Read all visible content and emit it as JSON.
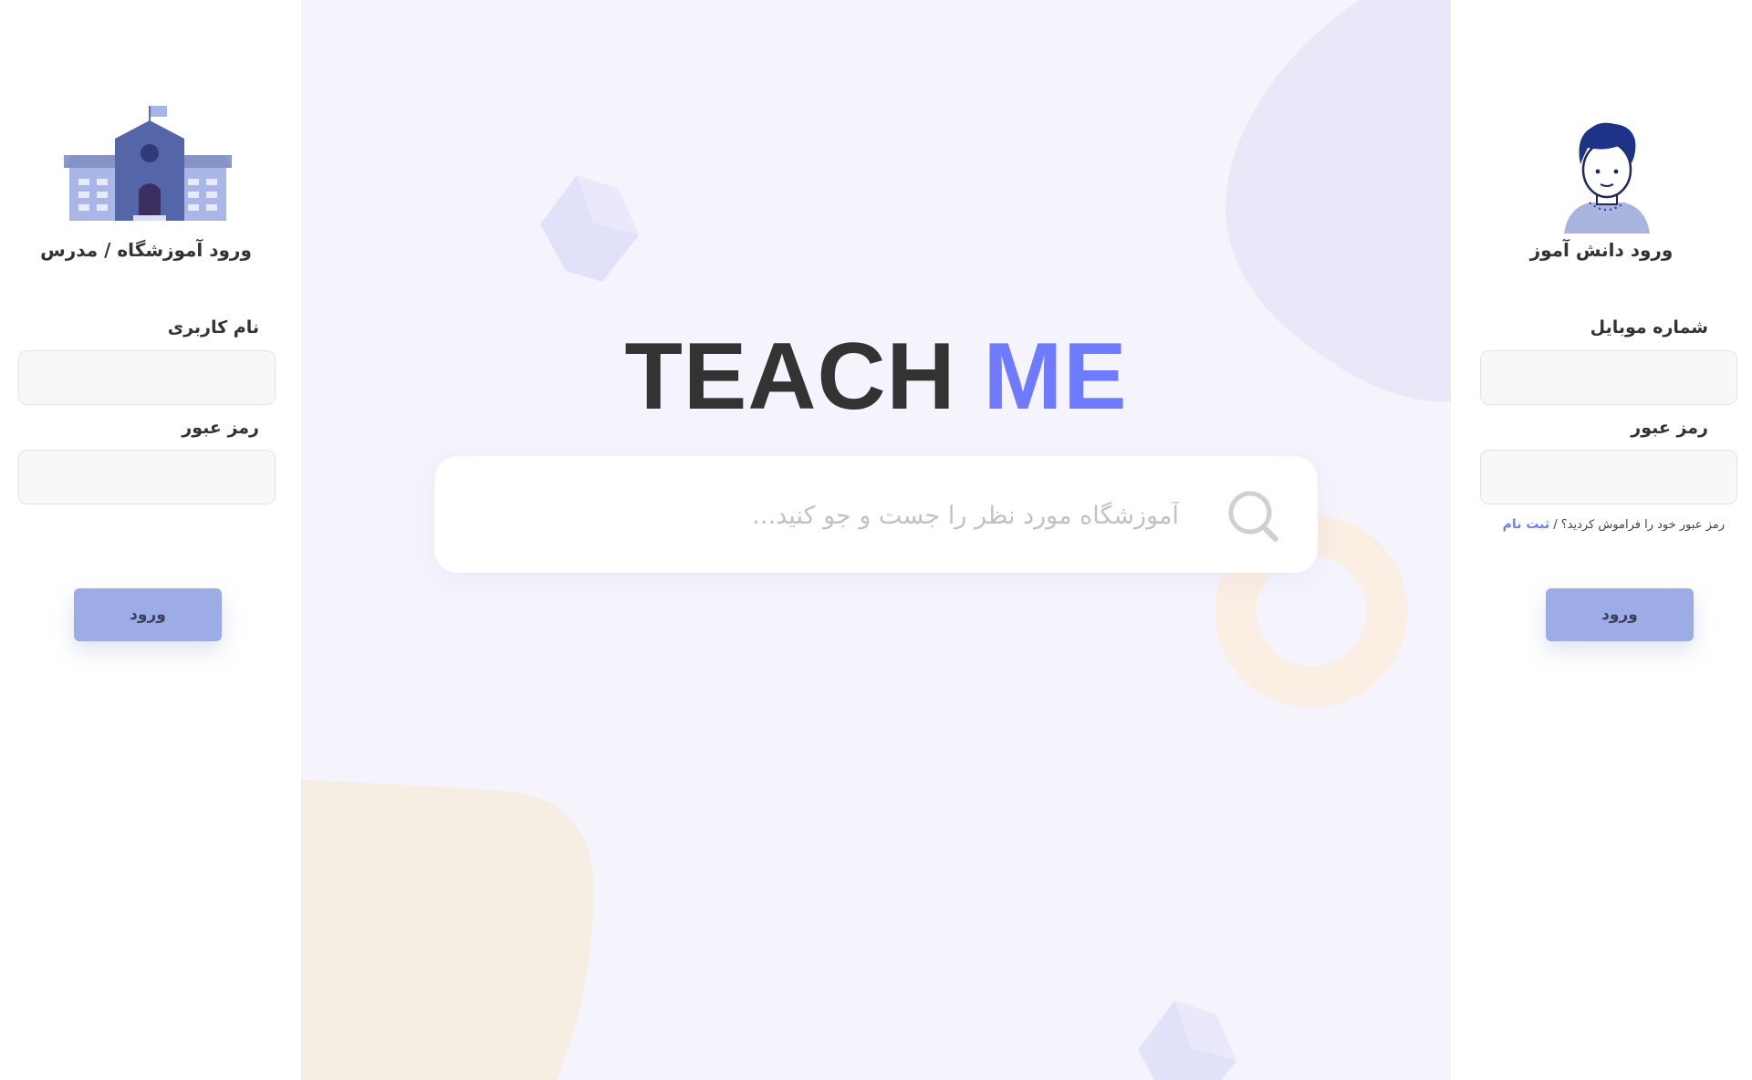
{
  "teacher_panel": {
    "title": "ورود آموزشگاه / مدرس",
    "username_label": "نام کاربری",
    "password_label": "رمز عبور",
    "login_button": "ورود",
    "illustration": "school-building-icon"
  },
  "student_panel": {
    "title": "ورود دانش آموز",
    "mobile_label": "شماره موبایل",
    "password_label": "رمز عبور",
    "forgot_text": "رمز عبور خود را فراموش کردید؟ /",
    "signup_link": "ثبت نام",
    "login_button": "ورود",
    "illustration": "student-avatar-icon"
  },
  "hero": {
    "logo_part1": "TEACH",
    "logo_part2": "ME",
    "search_placeholder": "آموزشگاه مورد نظر را جست و جو کنید...",
    "search_icon": "search-icon"
  },
  "colors": {
    "accent": "#6f7bff",
    "button": "#9dabe6",
    "center_bg": "#f5f4fc",
    "panel_bg": "#ffffff"
  }
}
